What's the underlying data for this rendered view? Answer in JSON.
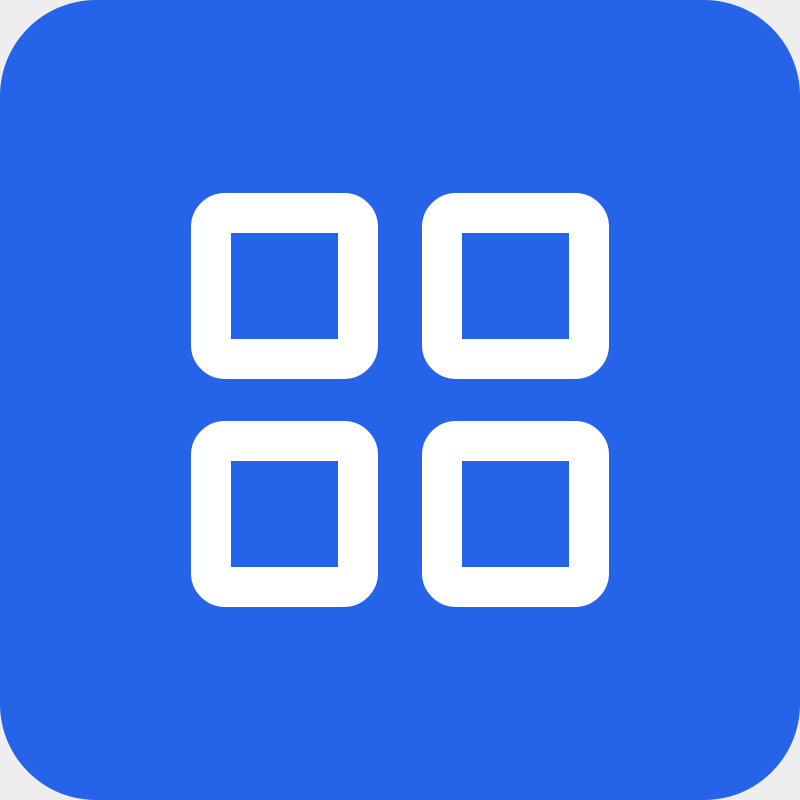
{
  "app_icon": {
    "icon": "grid-icon",
    "background_color": "#2563e8",
    "glyph_color": "#ffffff",
    "cell_count": 4
  }
}
